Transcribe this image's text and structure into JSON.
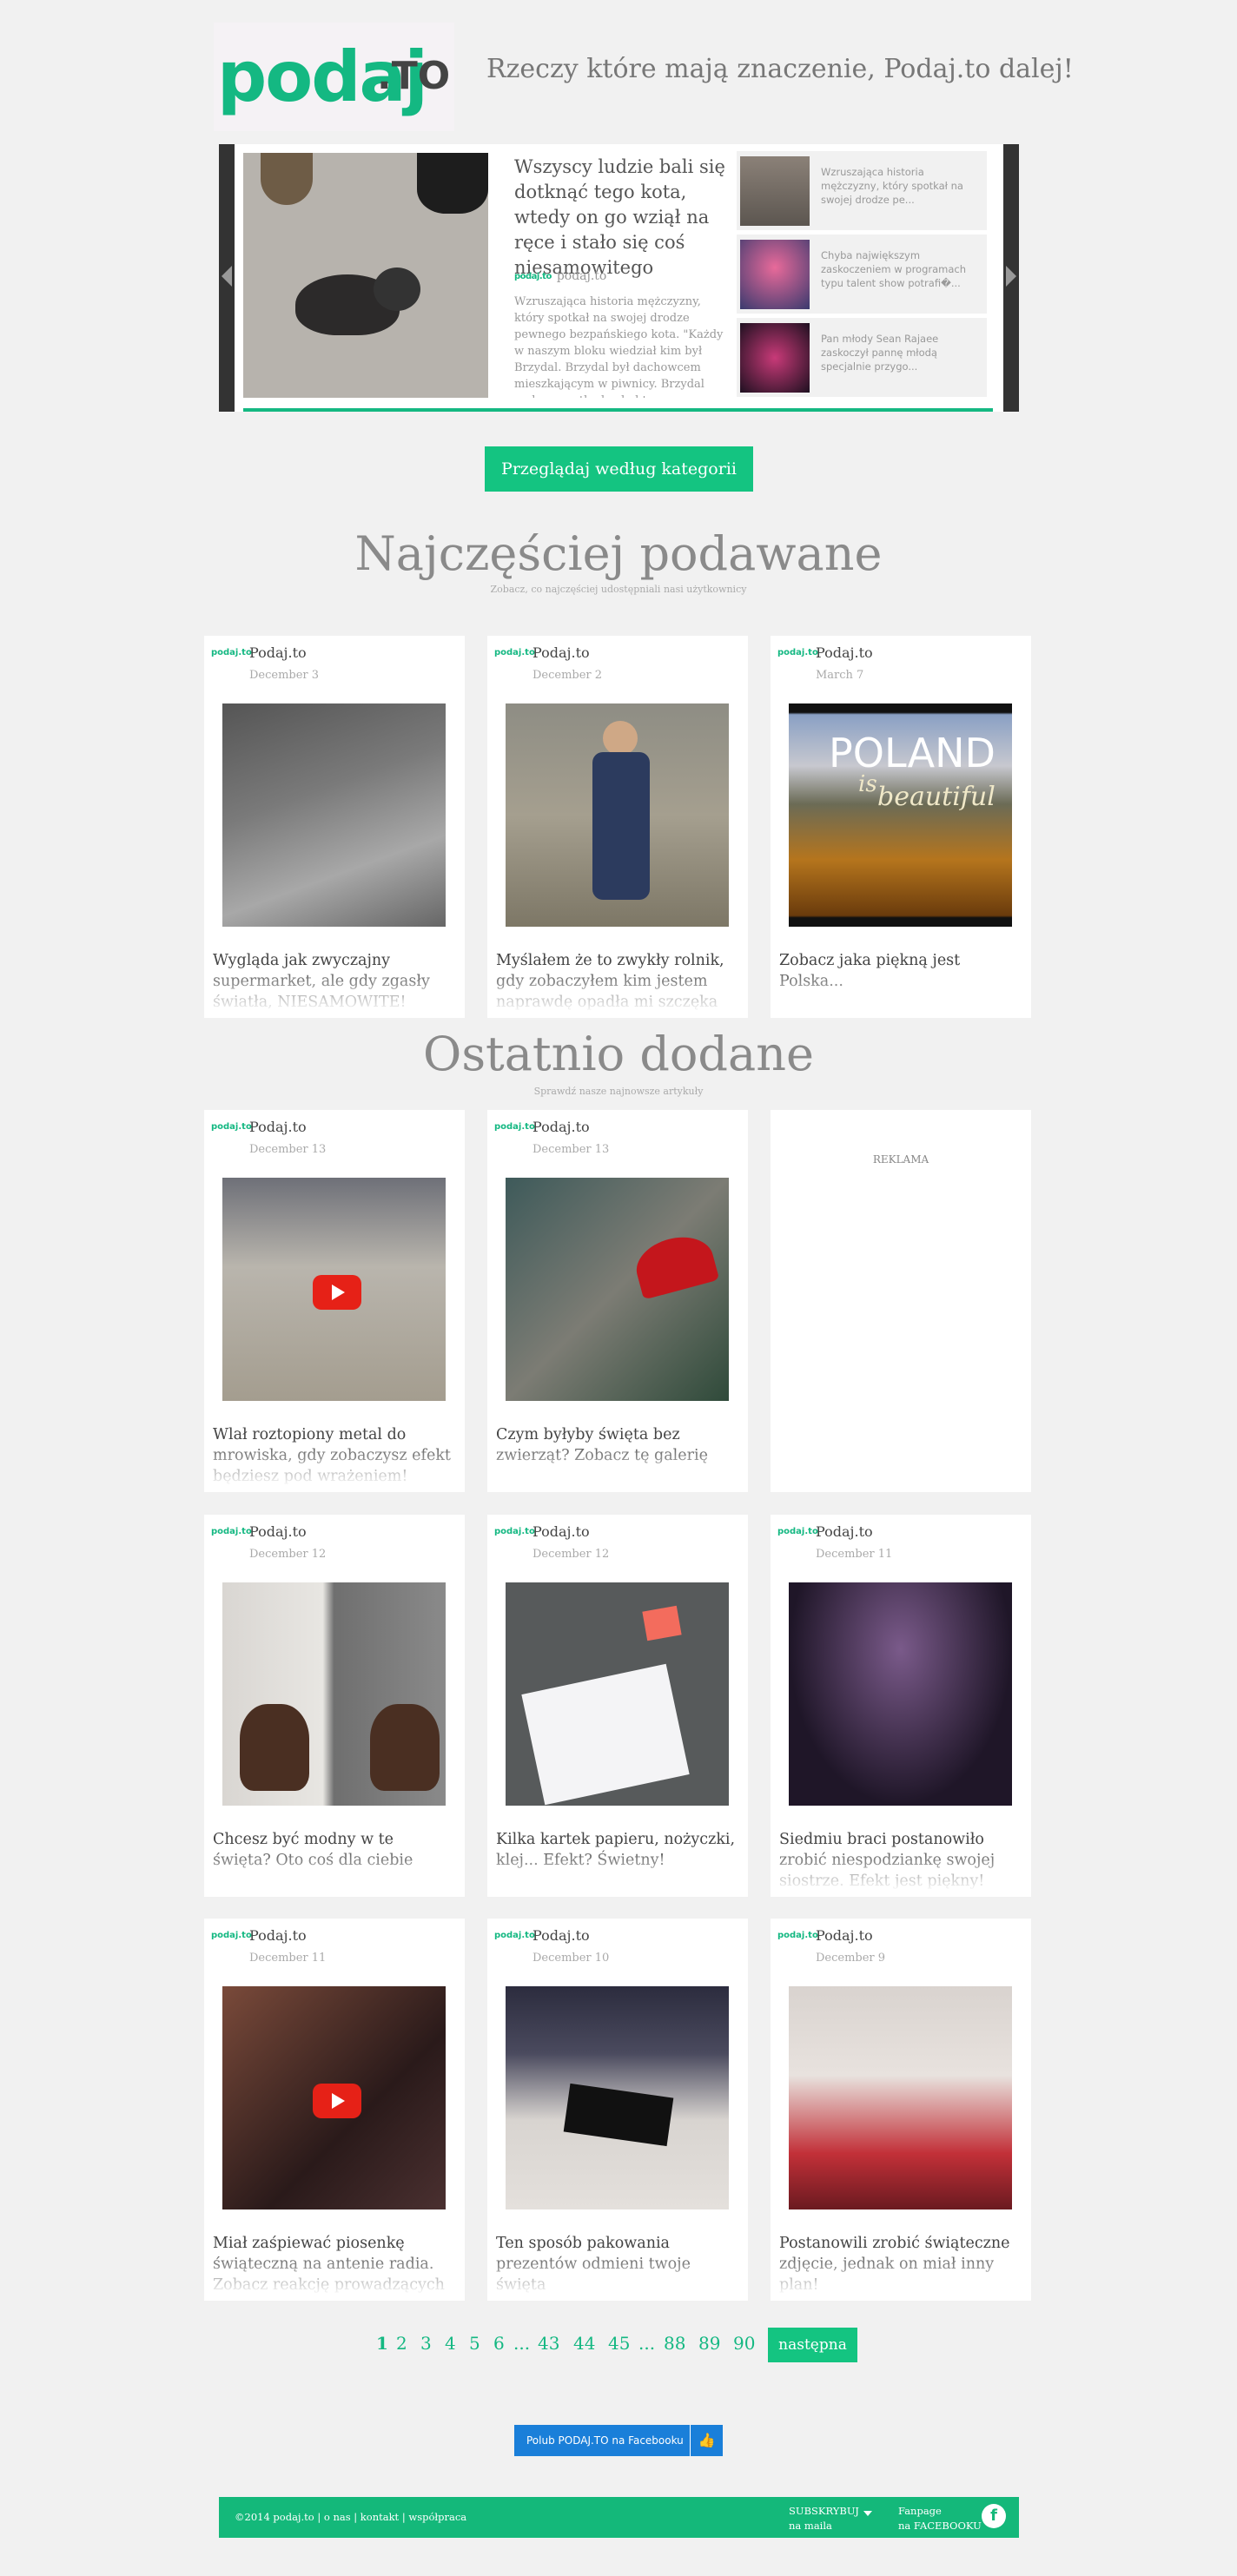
{
  "header": {
    "logo_text": "podaj",
    "logo_suffix": ".TO",
    "tagline": "Rzeczy które mają znaczenie, Podaj.to dalej!"
  },
  "slider": {
    "main_title": "Wszyscy ludzie bali się dotknąć tego kota, wtedy on go wziął na ręce i stało się coś niesamowitego",
    "main_source": "podaj.to",
    "main_desc": "Wzruszająca historia mężczyzny, który spotkał na swojej drodze pewnego bezpańskiego kota. \"Każdy w naszym bloku wiedział kim był Brzydal. Brzydal był dachowcem mieszkającym w piwnicy. Brzydal nade wszystko kochał trzy rzeczy: walczyć, wyjadać ze",
    "side": [
      {
        "text": "Wzruszająca historia mężczyzny, który spotkał na swojej drodze pe..."
      },
      {
        "text": "Chyba największym zaskoczeniem w programach typu talent show potrafi�..."
      },
      {
        "text": "Pan młody Sean Rajaee zaskoczył pannę młodą specjalnie przygo..."
      }
    ]
  },
  "category_button": "Przeglądaj według kategorii",
  "popular": {
    "title": "Najczęściej podawane",
    "subtitle": "Zobacz, co najczęściej udostępniali nasi użytkownicy",
    "cards": [
      {
        "name": "Podaj.to",
        "date": "December 3",
        "title": "Wygląda jak zwyczajny supermarket, ale gdy zgasły światła, NIESAMOWITE!"
      },
      {
        "name": "Podaj.to",
        "date": "December 2",
        "title": "Myślałem że to zwykły rolnik, gdy zobaczyłem kim jestem naprawdę opadła mi szczęka"
      },
      {
        "name": "Podaj.to",
        "date": "March 7",
        "title": "Zobacz jaka piękną jest Polska...",
        "img_text1": "POLAND",
        "img_text2": "is",
        "img_text3": "beautiful"
      }
    ]
  },
  "recent": {
    "title": "Ostatnio dodane",
    "subtitle": "Sprawdź nasze najnowsze artykuły",
    "ad_label": "REKLAMA",
    "cards": [
      {
        "name": "Podaj.to",
        "date": "December 13",
        "title": "Wlał roztopiony metal do mrowiska, gdy zobaczysz efekt będziesz pod wrażeniem!"
      },
      {
        "name": "Podaj.to",
        "date": "December 13",
        "title": "Czym byłyby święta bez zwierząt? Zobacz tę galerię"
      },
      {
        "name": "Podaj.to",
        "date": "December 12",
        "title": "Chcesz być modny w te święta? Oto coś dla ciebie"
      },
      {
        "name": "Podaj.to",
        "date": "December 12",
        "title": "Kilka kartek papieru, nożyczki, klej... Efekt? Świetny!"
      },
      {
        "name": "Podaj.to",
        "date": "December 11",
        "title": "Siedmiu braci postanowiło zrobić niespodziankę swojej siostrze. Efekt jest piękny!"
      },
      {
        "name": "Podaj.to",
        "date": "December 11",
        "title": "Miał zaśpiewać piosenkę świąteczną na antenie radia. Zobacz reakcję prowadzących"
      },
      {
        "name": "Podaj.to",
        "date": "December 10",
        "title": "Ten sposób pakowania prezentów odmieni twoje święta"
      },
      {
        "name": "Podaj.to",
        "date": "December 9",
        "title": "Postanowili zrobić świąteczne zdjęcie, jednak on miał inny plan!"
      }
    ]
  },
  "card_logo": "podaj.to",
  "pagination": {
    "pages": [
      "1",
      "2",
      "3",
      "4",
      "5",
      "6",
      "...",
      "43",
      "44",
      "45",
      "...",
      "88",
      "89",
      "90"
    ],
    "current": "1",
    "next": "następna"
  },
  "facebook_button": "Polub PODAJ.TO na Facebooku",
  "footer": {
    "copyright": "©2014 podaj.to | o nas | kontakt | współpraca",
    "subscribe_line1": "SUBSKRYBUJ",
    "subscribe_line2": "na maila",
    "fanpage_line1": "Fanpage",
    "fanpage_line2": "na FACEBOOKU",
    "fb_letter": "f"
  },
  "colors": {
    "accent": "#14b882",
    "background": "#f1f1f1",
    "facebook": "#1a7fd9",
    "youtube": "#e62117"
  }
}
